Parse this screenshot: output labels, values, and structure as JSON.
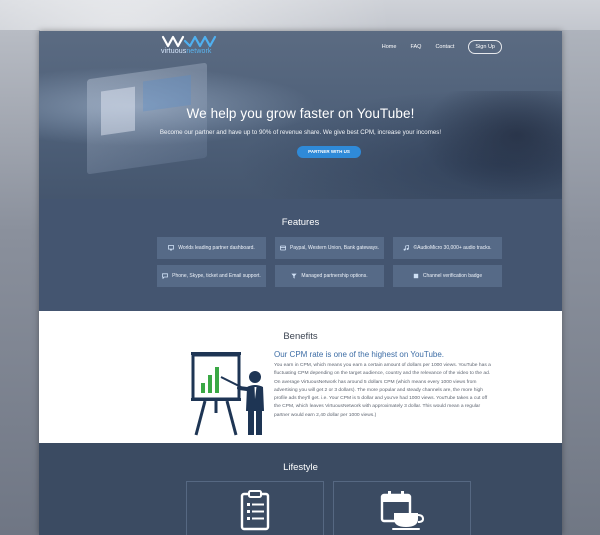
{
  "brand": {
    "name_part1": "virtuous",
    "name_part2": "network"
  },
  "nav": {
    "items": [
      "Home",
      "FAQ",
      "Contact"
    ],
    "signup_label": "Sign Up"
  },
  "hero": {
    "title": "We help you grow faster on YouTube!",
    "subtitle": "Become our partner and have up to 90% of revenue share. We give best CPM, increase your incomes!",
    "cta_label": "PARTNER WITH US"
  },
  "features": {
    "title": "Features",
    "items": [
      {
        "label": "Worlds leading partner dashboard.",
        "icon": "monitor-icon"
      },
      {
        "label": "Paypal, Western Union, Bank gateways.",
        "icon": "card-icon"
      },
      {
        "label": "©AudioMicro 30,000+ audio tracks.",
        "icon": "music-icon"
      },
      {
        "label": "Phone, Skype, ticket and Email support.",
        "icon": "chat-icon"
      },
      {
        "label": "Managed partnership options.",
        "icon": "filter-icon"
      },
      {
        "label": "Channel verification badge",
        "icon": "badge-icon"
      }
    ]
  },
  "benefits": {
    "title": "Benefits",
    "heading": "Our CPM rate is one of the highest on YouTube.",
    "body": "You earn in CPM, which means you earn a certain amount of dollars per 1000 views. YouTube has a fluctuating CPM depending on the target audience, country and the relevance of the video to the ad. On average VirtuousNetwork has around 5 dollars CPM (which means every 1000 views from advertising you will get 2 or 3 dollars). The more popular and steady channels are, the more high profile ads they'll get. i.e. Your CPM is 5 dollar and you've had 1000 views. YouTube takes a cut off the CPM, which leaves VirtuousNetwork with approximately 3 dollar. This would mean a regular partner would earn 2,40 dollar per 1000 views.)"
  },
  "lifestyle": {
    "title": "Lifestyle"
  },
  "colors": {
    "accent": "#2f8ad8",
    "features_bg": "#445570",
    "tile_bg": "#566a87",
    "heading_blue": "#3d6da5"
  }
}
